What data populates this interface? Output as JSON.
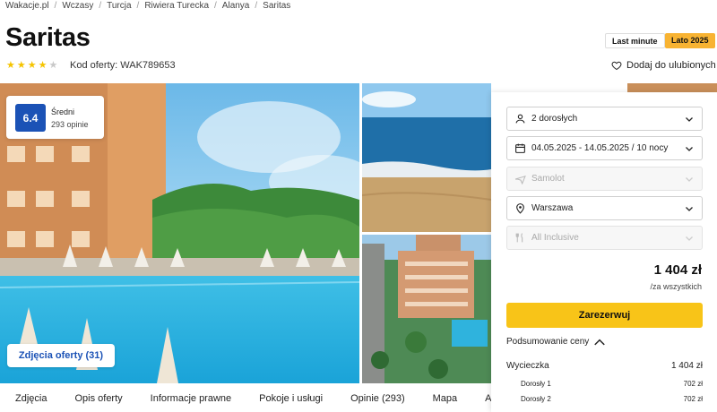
{
  "breadcrumb": [
    "Wakacje.pl",
    "Wczasy",
    "Turcja",
    "Riwiera Turecka",
    "Alanya",
    "Saritas"
  ],
  "title": "Saritas",
  "stars": {
    "filled": 4,
    "total": 5
  },
  "offer_code": "Kod oferty: WAK789653",
  "badges": {
    "last_minute": "Last minute",
    "season": "Lato 2025"
  },
  "favorite_label": "Dodaj do ulubionych",
  "rating": {
    "score": "6.4",
    "label": "Średni",
    "count": "293 opinie"
  },
  "photos_button": "Zdjęcia oferty (31)",
  "booking": {
    "travellers": "2 dorosłych",
    "dates": "04.05.2025 - 14.05.2025 / 10 nocy",
    "transport": "Samolot",
    "departure": "Warszawa",
    "board": "All Inclusive",
    "price": "1 404 zł",
    "price_note": "/za wszystkich",
    "book_label": "Zarezerwuj",
    "summary_label": "Podsumowanie ceny",
    "trip_label": "Wycieczka",
    "trip_price": "1 404 zł",
    "adult1_label": "Dorosły 1",
    "adult1_price": "702 zł",
    "adult2_label": "Dorosły 2",
    "adult2_price": "702 zł"
  },
  "tabs": [
    "Zdjęcia",
    "Opis oferty",
    "Informacje prawne",
    "Pokoje i usługi",
    "Opinie (293)",
    "Mapa",
    "Atrakcje"
  ],
  "colors": {
    "accent_blue": "#1b52b6",
    "cta_yellow": "#f8c418",
    "season_orange": "#f8b332",
    "star": "#f5c400"
  },
  "icons": [
    "person-icon",
    "calendar-icon",
    "plane-icon",
    "location-pin-icon",
    "fork-knife-icon",
    "heart-icon",
    "chevron-down-icon",
    "chevron-up-icon"
  ]
}
